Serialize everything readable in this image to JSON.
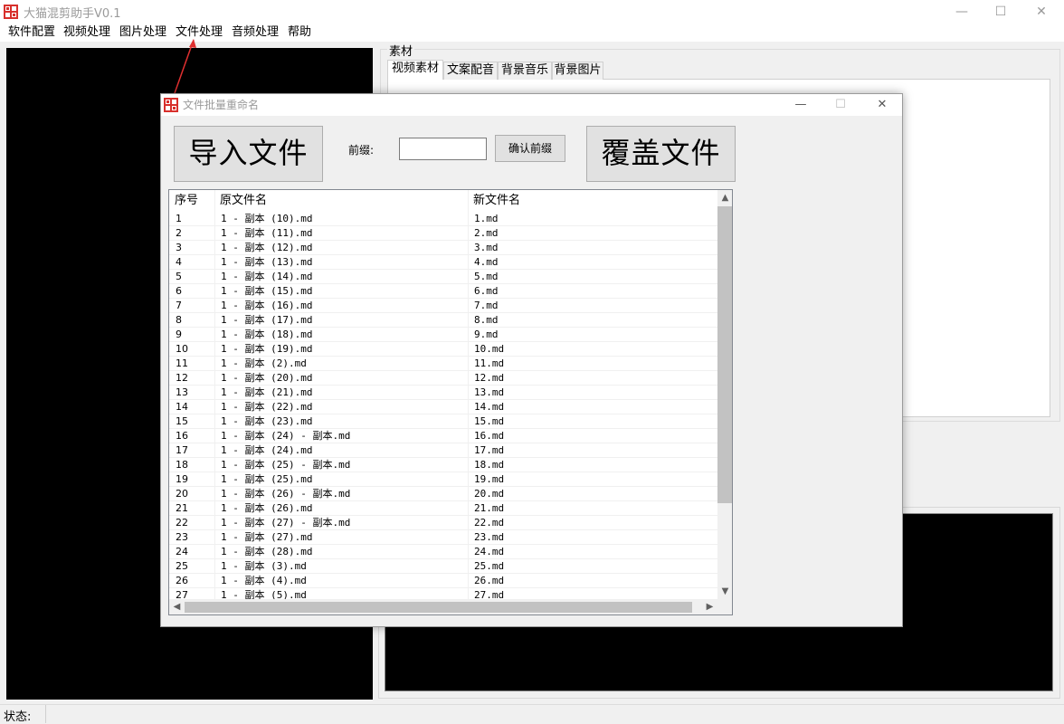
{
  "window": {
    "title": "大猫混剪助手V0.1",
    "controls": {
      "minimize": "—",
      "maximize": "☐",
      "close": "✕"
    }
  },
  "menu": [
    "软件配置",
    "视频处理",
    "图片处理",
    "文件处理",
    "音频处理",
    "帮助"
  ],
  "material": {
    "group_title": "素材",
    "tabs": [
      "视频素材",
      "文案配音",
      "背景音乐",
      "背景图片"
    ]
  },
  "status": {
    "label": "状态:"
  },
  "dialog": {
    "title": "文件批量重命名",
    "import_label": "导入文件",
    "prefix_label": "前缀:",
    "prefix_value": "",
    "confirm_label": "确认前缀",
    "overwrite_label": "覆盖文件",
    "columns": [
      "序号",
      "原文件名",
      "新文件名"
    ],
    "rows": [
      [
        "1",
        "1 - 副本 (10).md",
        "1.md"
      ],
      [
        "2",
        "1 - 副本 (11).md",
        "2.md"
      ],
      [
        "3",
        "1 - 副本 (12).md",
        "3.md"
      ],
      [
        "4",
        "1 - 副本 (13).md",
        "4.md"
      ],
      [
        "5",
        "1 - 副本 (14).md",
        "5.md"
      ],
      [
        "6",
        "1 - 副本 (15).md",
        "6.md"
      ],
      [
        "7",
        "1 - 副本 (16).md",
        "7.md"
      ],
      [
        "8",
        "1 - 副本 (17).md",
        "8.md"
      ],
      [
        "9",
        "1 - 副本 (18).md",
        "9.md"
      ],
      [
        "10",
        "1 - 副本 (19).md",
        "10.md"
      ],
      [
        "11",
        "1 - 副本 (2).md",
        "11.md"
      ],
      [
        "12",
        "1 - 副本 (20).md",
        "12.md"
      ],
      [
        "13",
        "1 - 副本 (21).md",
        "13.md"
      ],
      [
        "14",
        "1 - 副本 (22).md",
        "14.md"
      ],
      [
        "15",
        "1 - 副本 (23).md",
        "15.md"
      ],
      [
        "16",
        "1 - 副本 (24) - 副本.md",
        "16.md"
      ],
      [
        "17",
        "1 - 副本 (24).md",
        "17.md"
      ],
      [
        "18",
        "1 - 副本 (25) - 副本.md",
        "18.md"
      ],
      [
        "19",
        "1 - 副本 (25).md",
        "19.md"
      ],
      [
        "20",
        "1 - 副本 (26) - 副本.md",
        "20.md"
      ],
      [
        "21",
        "1 - 副本 (26).md",
        "21.md"
      ],
      [
        "22",
        "1 - 副本 (27) - 副本.md",
        "22.md"
      ],
      [
        "23",
        "1 - 副本 (27).md",
        "23.md"
      ],
      [
        "24",
        "1 - 副本 (28).md",
        "24.md"
      ],
      [
        "25",
        "1 - 副本 (3).md",
        "25.md"
      ],
      [
        "26",
        "1 - 副本 (4).md",
        "26.md"
      ],
      [
        "27",
        "1 - 副本 (5).md",
        "27.md"
      ]
    ],
    "scroll": {
      "up": "▲",
      "down": "▼",
      "left": "◀",
      "right": "▶"
    }
  },
  "colors": {
    "annotation_arrow": "#e03030",
    "icon_red": "#d8302c"
  }
}
